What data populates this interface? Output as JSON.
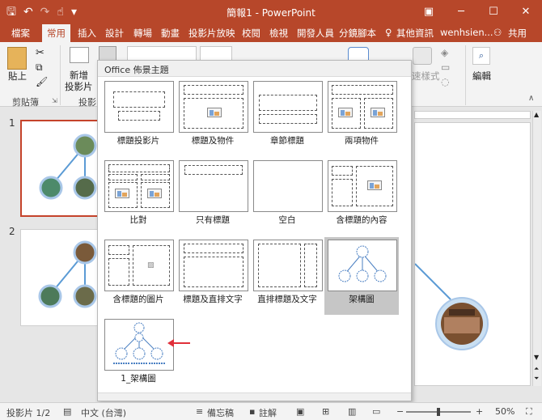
{
  "window": {
    "title": "簡報1 - PowerPoint"
  },
  "qat": {
    "save_icon": "save-icon",
    "undo_icon": "undo-icon",
    "redo_icon": "redo-icon",
    "touch_icon": "touch-mode-icon",
    "customize_icon": "customize-icon"
  },
  "tabs": [
    "檔案",
    "常用",
    "插入",
    "設計",
    "轉場",
    "動畫",
    "投影片放映",
    "校閱",
    "檢視",
    "開發人員",
    "分鏡腳本"
  ],
  "tell_me": "其他資訊",
  "user": "wenhsien...",
  "share": "共用",
  "ribbon": {
    "paste": "貼上",
    "clipboard_group": "剪貼簿",
    "new_slide": "新增",
    "new_slide2": "投影片",
    "slides_group": "投影",
    "quick_styles": "速樣式",
    "editing": "編輯"
  },
  "slides": [
    {
      "num": "1"
    },
    {
      "num": "2"
    }
  ],
  "gallery": {
    "header": "Office 佈景主題",
    "layouts": [
      {
        "label": "標題投影片"
      },
      {
        "label": "標題及物件"
      },
      {
        "label": "章節標題"
      },
      {
        "label": "兩項物件"
      },
      {
        "label": "比對"
      },
      {
        "label": "只有標題"
      },
      {
        "label": "空白"
      },
      {
        "label": "含標題的內容"
      },
      {
        "label": "含標題的圖片"
      },
      {
        "label": "標題及直排文字"
      },
      {
        "label": "直排標題及文字"
      },
      {
        "label": "架構圖"
      },
      {
        "label": "1_架構圖"
      }
    ]
  },
  "status": {
    "slide_info": "投影片 1/2",
    "language": "中文 (台灣)",
    "notes": "備忘稿",
    "comments": "註解",
    "zoom": "50%"
  },
  "colors": {
    "accent": "#b7472a",
    "selection": "#c5432b",
    "arrow": "#e0303a"
  }
}
